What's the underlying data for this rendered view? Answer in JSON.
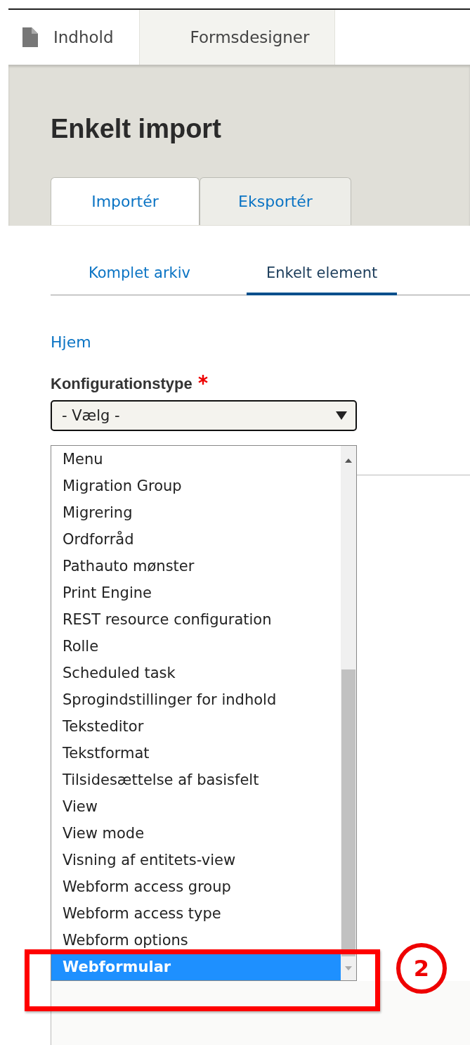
{
  "top_tabs": [
    {
      "label": "Indhold",
      "icon": true,
      "selected": true
    },
    {
      "label": "Formsdesigner",
      "icon": false,
      "selected": false
    }
  ],
  "page_title": "Enkelt import",
  "primary_tabs": [
    {
      "label": "Importér",
      "selected": true
    },
    {
      "label": "Eksportér",
      "selected": false
    }
  ],
  "secondary_tabs": [
    {
      "label": "Komplet arkiv",
      "selected": false
    },
    {
      "label": "Enkelt element",
      "selected": true
    }
  ],
  "breadcrumb": "Hjem",
  "field": {
    "label": "Konfigurationstype",
    "required": true,
    "value": "- Vælg -"
  },
  "options": [
    {
      "label": "Menu",
      "selected": false
    },
    {
      "label": "Migration Group",
      "selected": false
    },
    {
      "label": "Migrering",
      "selected": false
    },
    {
      "label": "Ordforråd",
      "selected": false
    },
    {
      "label": "Pathauto mønster",
      "selected": false
    },
    {
      "label": "Print Engine",
      "selected": false
    },
    {
      "label": "REST resource configuration",
      "selected": false
    },
    {
      "label": "Rolle",
      "selected": false
    },
    {
      "label": "Scheduled task",
      "selected": false
    },
    {
      "label": "Sprogindstillinger for indhold",
      "selected": false
    },
    {
      "label": "Teksteditor",
      "selected": false
    },
    {
      "label": "Tekstformat",
      "selected": false
    },
    {
      "label": "Tilsidesættelse af basisfelt",
      "selected": false
    },
    {
      "label": "View",
      "selected": false
    },
    {
      "label": "View mode",
      "selected": false
    },
    {
      "label": "Visning af entitets-view",
      "selected": false
    },
    {
      "label": "Webform access group",
      "selected": false
    },
    {
      "label": "Webform access type",
      "selected": false
    },
    {
      "label": "Webform options",
      "selected": false
    },
    {
      "label": "Webformular",
      "selected": true
    }
  ],
  "annotation": {
    "number": "2"
  }
}
